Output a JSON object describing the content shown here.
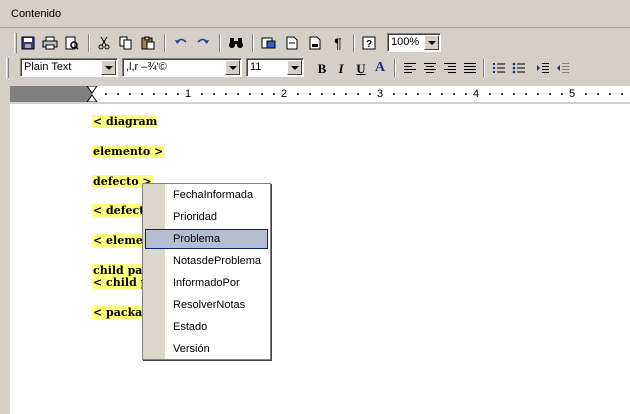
{
  "window": {
    "title": "Contenido"
  },
  "toolbar1": {
    "zoom": "100%"
  },
  "toolbar2": {
    "style": "Plain Text",
    "font": ",l,r –¾'©",
    "size": "11",
    "bold": "B",
    "italic": "I",
    "underline": "U",
    "color": "A"
  },
  "ruler": {
    "labels": [
      "1",
      "2",
      "3",
      "4",
      "5"
    ]
  },
  "document": {
    "lines": [
      "< diagram",
      "elemento >",
      "defecto >",
      "< defecto",
      "< elemen",
      "child pac",
      "< child pa",
      "< packag"
    ]
  },
  "context_menu": {
    "items": [
      "FechaInformada",
      "Prioridad",
      "Problema",
      "NotasdeProblema",
      "InformadoPor",
      "ResolverNotas",
      "Estado",
      "Versión"
    ],
    "selected": "Problema"
  }
}
